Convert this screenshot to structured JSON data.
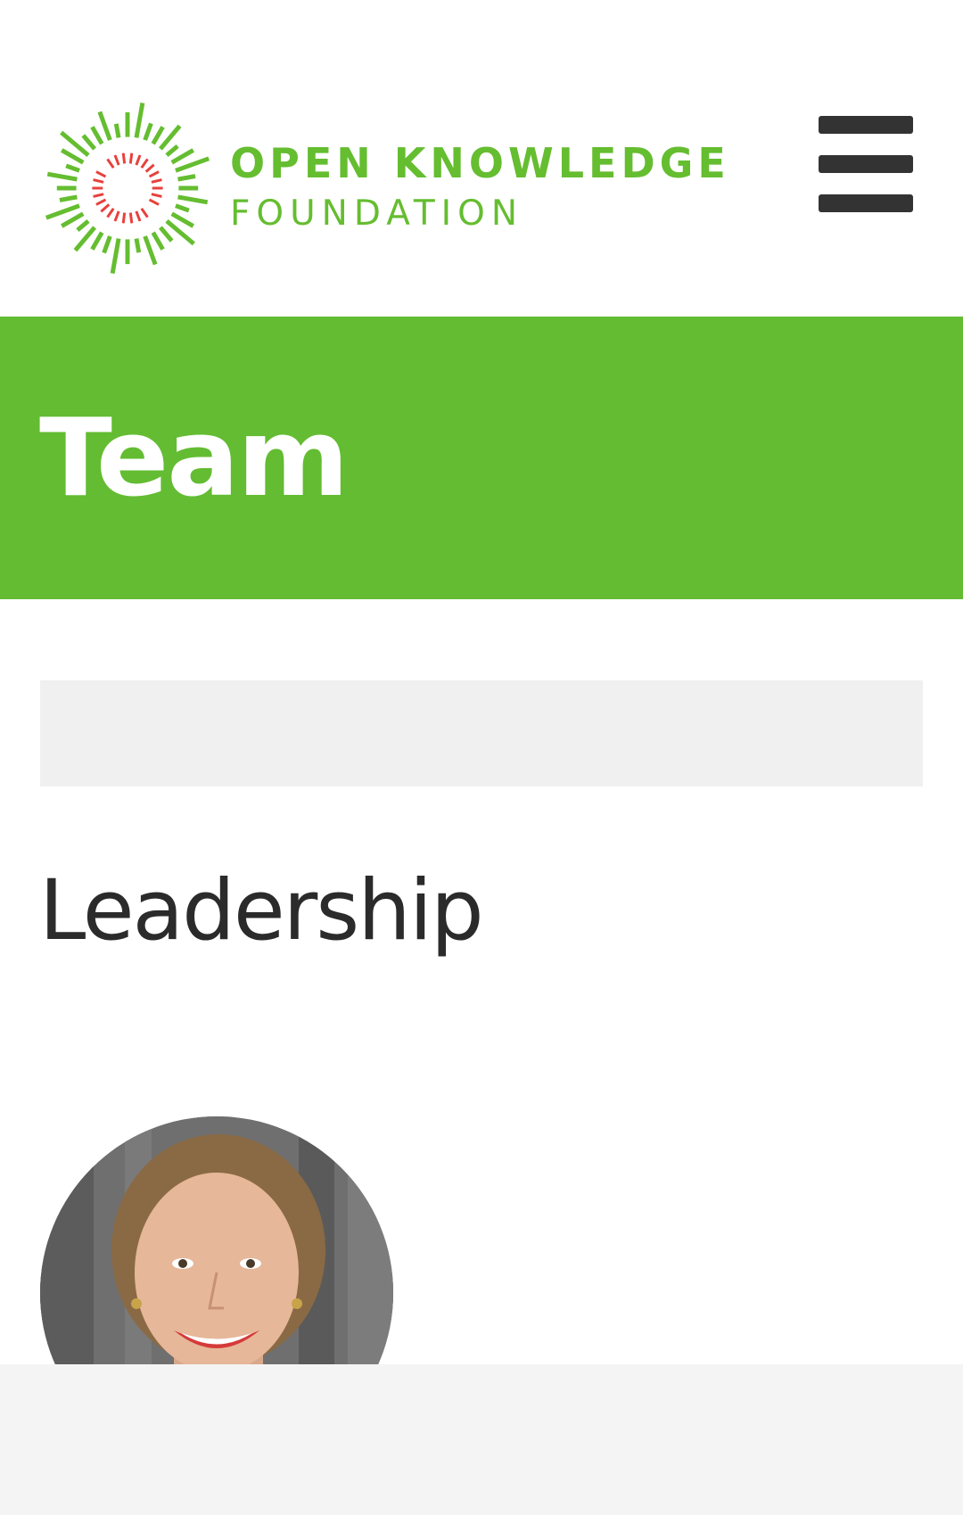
{
  "header": {
    "logo_line_1": "OPEN KNOWLEDGE",
    "logo_line_2": "FOUNDATION",
    "brand_color": "#65bd30",
    "menu_icon": "hamburger-menu-icon"
  },
  "banner": {
    "title": "Team",
    "background_color": "#63bc32"
  },
  "content": {
    "section_heading": "Leadership"
  },
  "colors": {
    "heading_text": "#2b2b2b",
    "menu_icon": "#333333",
    "logo_inner_ring": "#e8403c",
    "placeholder_block": "#f0f0f0",
    "bottom_bar": "#f4f4f4"
  }
}
